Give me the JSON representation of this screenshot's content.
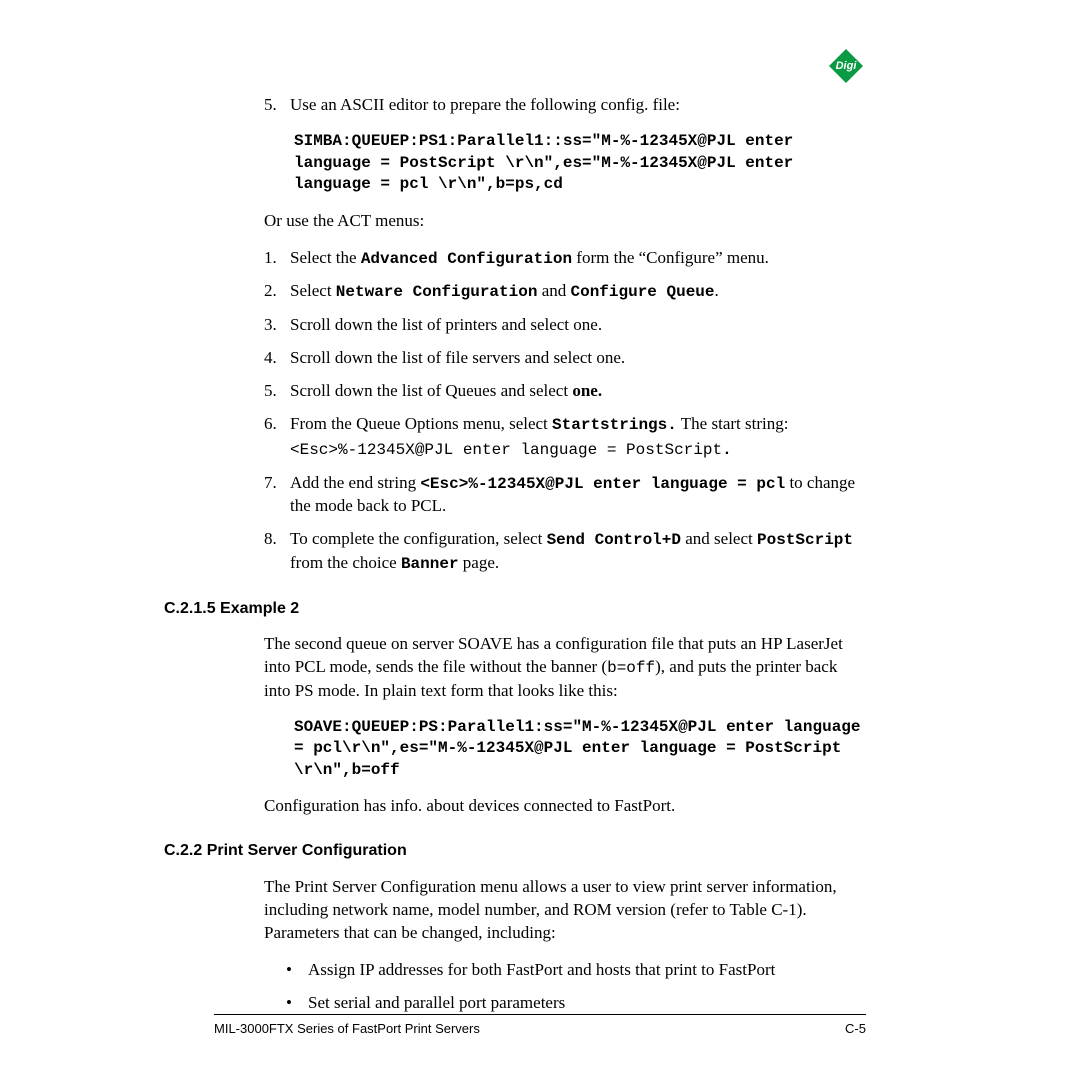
{
  "topItem": {
    "num": "5.",
    "text": "Use an ASCII editor to prepare the following config. file:"
  },
  "code1": "SIMBA:QUEUEP:PS1:Parallel1::ss=\"M-%-12345X@PJL enter language = PostScript \\r\\n\",es=\"M-%-12345X@PJL enter language = pcl \\r\\n\",b=ps,cd",
  "orUse": "Or use the ACT menus:",
  "steps": [
    {
      "num": "1.",
      "parts": [
        {
          "t": "Select the ",
          "c": ""
        },
        {
          "t": "Advanced Configuration",
          "c": "mono-bold"
        },
        {
          "t": " form the “Configure” menu.",
          "c": ""
        }
      ]
    },
    {
      "num": "2.",
      "parts": [
        {
          "t": "Select ",
          "c": ""
        },
        {
          "t": "Netware Configuration",
          "c": "mono-bold"
        },
        {
          "t": " and ",
          "c": ""
        },
        {
          "t": "Configure Queue",
          "c": "mono-bold"
        },
        {
          "t": ".",
          "c": ""
        }
      ]
    },
    {
      "num": "3.",
      "parts": [
        {
          "t": "Scroll down the list of printers and select one.",
          "c": ""
        }
      ]
    },
    {
      "num": "4.",
      "parts": [
        {
          "t": "Scroll down the list of file servers and select one.",
          "c": ""
        }
      ]
    },
    {
      "num": "5.",
      "parts": [
        {
          "t": "Scroll down the list of Queues and select ",
          "c": ""
        },
        {
          "t": "one.",
          "c": "bold-serif"
        }
      ]
    },
    {
      "num": "6.",
      "parts": [
        {
          "t": "From the Queue Options menu, select ",
          "c": ""
        },
        {
          "t": "Startstrings.",
          "c": "mono-bold"
        },
        {
          "t": " The start string: ",
          "c": ""
        }
      ],
      "sub": [
        {
          "t": "<Esc>%-12345X@PJL enter language = PostScript",
          "c": "mono"
        },
        {
          "t": ".",
          "c": "mono-bold"
        }
      ]
    },
    {
      "num": "7.",
      "parts": [
        {
          "t": "Add the end string ",
          "c": ""
        },
        {
          "t": "<Esc>%-12345X@PJL enter language = pcl",
          "c": "mono-bold"
        },
        {
          "t": " to change the mode back to PCL.",
          "c": ""
        }
      ]
    },
    {
      "num": "8.",
      "parts": [
        {
          "t": "To complete the configuration, select ",
          "c": ""
        },
        {
          "t": "Send Control+D",
          "c": "mono-bold"
        },
        {
          "t": " and select ",
          "c": ""
        },
        {
          "t": "PostScript",
          "c": "mono-bold"
        },
        {
          "t": " from the choice ",
          "c": ""
        },
        {
          "t": "Banner",
          "c": "mono-bold"
        },
        {
          "t": " page.",
          "c": ""
        }
      ]
    }
  ],
  "section1": "C.2.1.5 Example 2",
  "ex2para_parts": [
    {
      "t": "The second queue on server SOAVE has a configuration file that puts an HP LaserJet into PCL mode, sends the file without the banner (",
      "c": ""
    },
    {
      "t": "b=off",
      "c": "mono"
    },
    {
      "t": "), and puts the printer back into PS mode. In plain text form that looks like this:",
      "c": ""
    }
  ],
  "code2": "SOAVE:QUEUEP:PS:Parallel1:ss=\"M-%-12345X@PJL enter language = pcl\\r\\n\",es=\"M-%-12345X@PJL enter language = PostScript \\r\\n\",b=off",
  "configHas": "Configuration has info. about devices connected to FastPort.",
  "section2": "C.2.2 Print Server Configuration",
  "psPara": "The Print Server Configuration menu allows a user to view print server information, including network name, model number, and ROM version (refer to Table C-1). Parameters that can be changed, including:",
  "bullets": [
    "Assign IP addresses for both FastPort and hosts that print to FastPort",
    "Set serial and parallel port parameters"
  ],
  "footer": {
    "left": "MIL-3000FTX Series of FastPort Print Servers",
    "right": "C-5"
  }
}
